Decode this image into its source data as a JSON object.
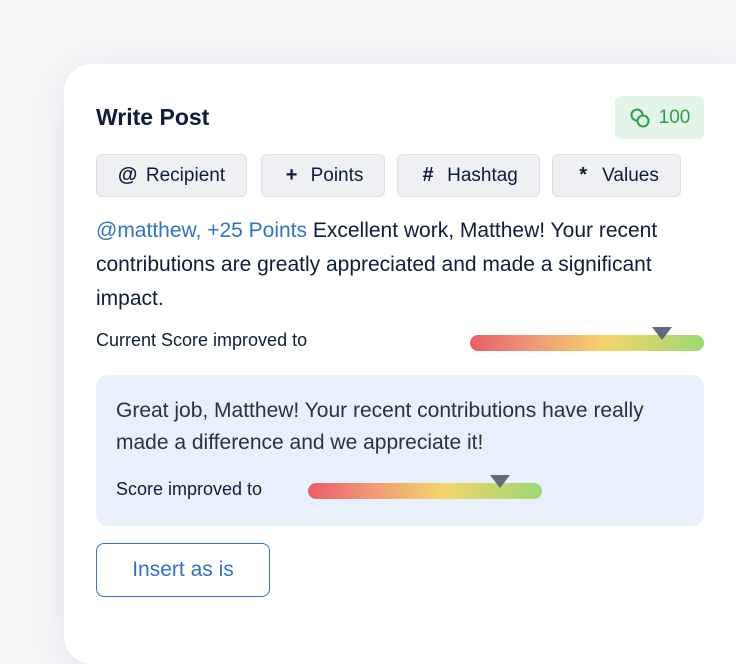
{
  "post": {
    "title": "Write Post",
    "points_balance": "100",
    "chips": [
      {
        "glyph": "@",
        "label": "Recipient"
      },
      {
        "glyph": "+",
        "label": "Points"
      },
      {
        "glyph": "#",
        "label": "Hashtag"
      },
      {
        "glyph": "*",
        "label": "Values"
      }
    ],
    "message": {
      "mention": "@matthew, +25 Points",
      "text": " Excellent work, Matthew! Your recent contributions are greatly appreciated and made a significant impact."
    },
    "current_score": {
      "label": "Current Score improved to",
      "level_fraction": 0.82
    }
  },
  "suggestion": {
    "text": "Great job, Matthew! Your recent contributions have really made a difference and we appreciate it!",
    "score_label": "Score improved to",
    "level_fraction": 0.82
  },
  "actions": {
    "insert_label": "Insert as is"
  },
  "colors": {
    "accent_blue": "#2f73c9",
    "badge_green": "#2f9e4c",
    "badge_bg": "#e3f5e8",
    "suggest_bg": "#e8f1fb"
  },
  "icons": {
    "points_badge": "coins-icon",
    "recipient_chip": "at-icon",
    "points_chip": "plus-icon",
    "hashtag_chip": "hash-icon",
    "values_chip": "asterisk-icon",
    "score_marker": "triangle-marker-icon"
  }
}
